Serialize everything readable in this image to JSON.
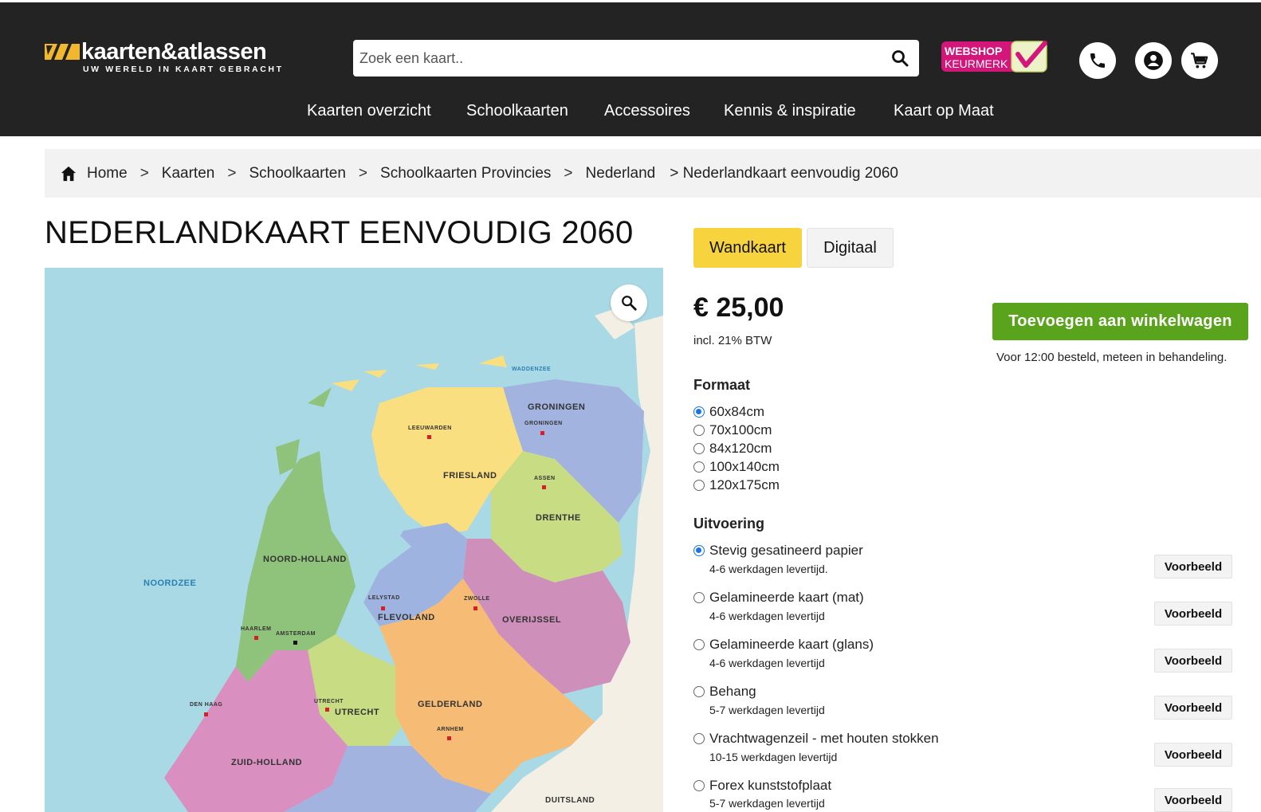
{
  "header": {
    "logo_text": "kaarten&atlassen",
    "logo_sub": "UW WERELD IN KAART GEBRACHT",
    "search_placeholder": "Zoek een kaart..",
    "keurmerk_line1": "WEBSHOP",
    "keurmerk_line2": "KEURMERK",
    "nav": [
      "Kaarten overzicht",
      "Schoolkaarten",
      "Accessoires",
      "Kennis & inspiratie",
      "Kaart op Maat"
    ]
  },
  "breadcrumb": {
    "items": [
      "Home",
      "Kaarten",
      "Schoolkaarten",
      "Schoolkaarten Provincies",
      "Nederland"
    ],
    "current": "> Nederlandkaart eenvoudig 2060",
    "separator": ">"
  },
  "product": {
    "title": "NEDERLANDKAART EENVOUDIG 2060",
    "tabs": [
      "Wandkaart",
      "Digitaal"
    ],
    "price": "€ 25,00",
    "vat": "incl. 21% BTW",
    "add_to_cart": "Toevoegen aan winkelwagen",
    "delivery_note": "Voor 12:00 besteld, meteen in behandeling.",
    "format_label": "Formaat",
    "formats": [
      "60x84cm",
      "70x100cm",
      "84x120cm",
      "100x140cm",
      "120x175cm"
    ],
    "selected_format": "60x84cm",
    "finish_label": "Uitvoering",
    "finishes": [
      {
        "name": "Stevig gesatineerd papier",
        "lead_time": "4-6 werkdagen levertijd."
      },
      {
        "name": "Gelamineerde kaart (mat)",
        "lead_time": "4-6 werkdagen levertijd"
      },
      {
        "name": "Gelamineerde kaart (glans)",
        "lead_time": "4-6 werkdagen levertijd"
      },
      {
        "name": "Behang",
        "lead_time": "5-7 werkdagen levertijd"
      },
      {
        "name": "Vrachtwagenzeil - met houten stokken",
        "lead_time": "10-15 werkdagen levertijd"
      },
      {
        "name": "Forex kunststofplaat",
        "lead_time": "5-7 werkdagen levertijd"
      }
    ],
    "preview_label": "Voorbeeld"
  },
  "map": {
    "labels": {
      "groningen": "GRONINGEN",
      "friesland": "FRIESLAND",
      "drenthe": "DRENTHE",
      "noord_holland": "NOORD-HOLLAND",
      "flevoland": "FLEVOLAND",
      "overijssel": "OVERIJSSEL",
      "utrecht": "UTRECHT",
      "gelderland": "GELDERLAND",
      "zuid_holland": "ZUID-HOLLAND",
      "noordzee": "NOORDZEE",
      "duitsland": "DUITSLAND",
      "waddenzee": "WADDENZEE",
      "leeuwarden": "LEEUWARDEN",
      "groningen_city": "GRONINGEN",
      "assen": "ASSEN",
      "lelystad": "LELYSTAD",
      "zwolle": "ZWOLLE",
      "haarlem": "HAARLEM",
      "amsterdam": "AMSTERDAM",
      "den_haag": "DEN HAAG",
      "utrecht_city": "UTRECHT",
      "arnhem": "ARNHEM"
    },
    "colors": {
      "sea": "#a9d9e5",
      "groningen": "#a3b3df",
      "friesland": "#f9df80",
      "drenthe": "#c7dc83",
      "noord_holland": "#8fc27a",
      "flevoland": "#9fb3e0",
      "overijssel": "#cf8fbb",
      "utrecht": "#c7dc83",
      "gelderland": "#f6bb75",
      "zuid_holland": "#d98fc0",
      "land_grey": "#f4efe4"
    }
  },
  "colors": {
    "header_bg": "#232323",
    "accent_yellow": "#f7d33d",
    "cta_green": "#5aa31c",
    "radio_blue": "#1a73e8"
  }
}
